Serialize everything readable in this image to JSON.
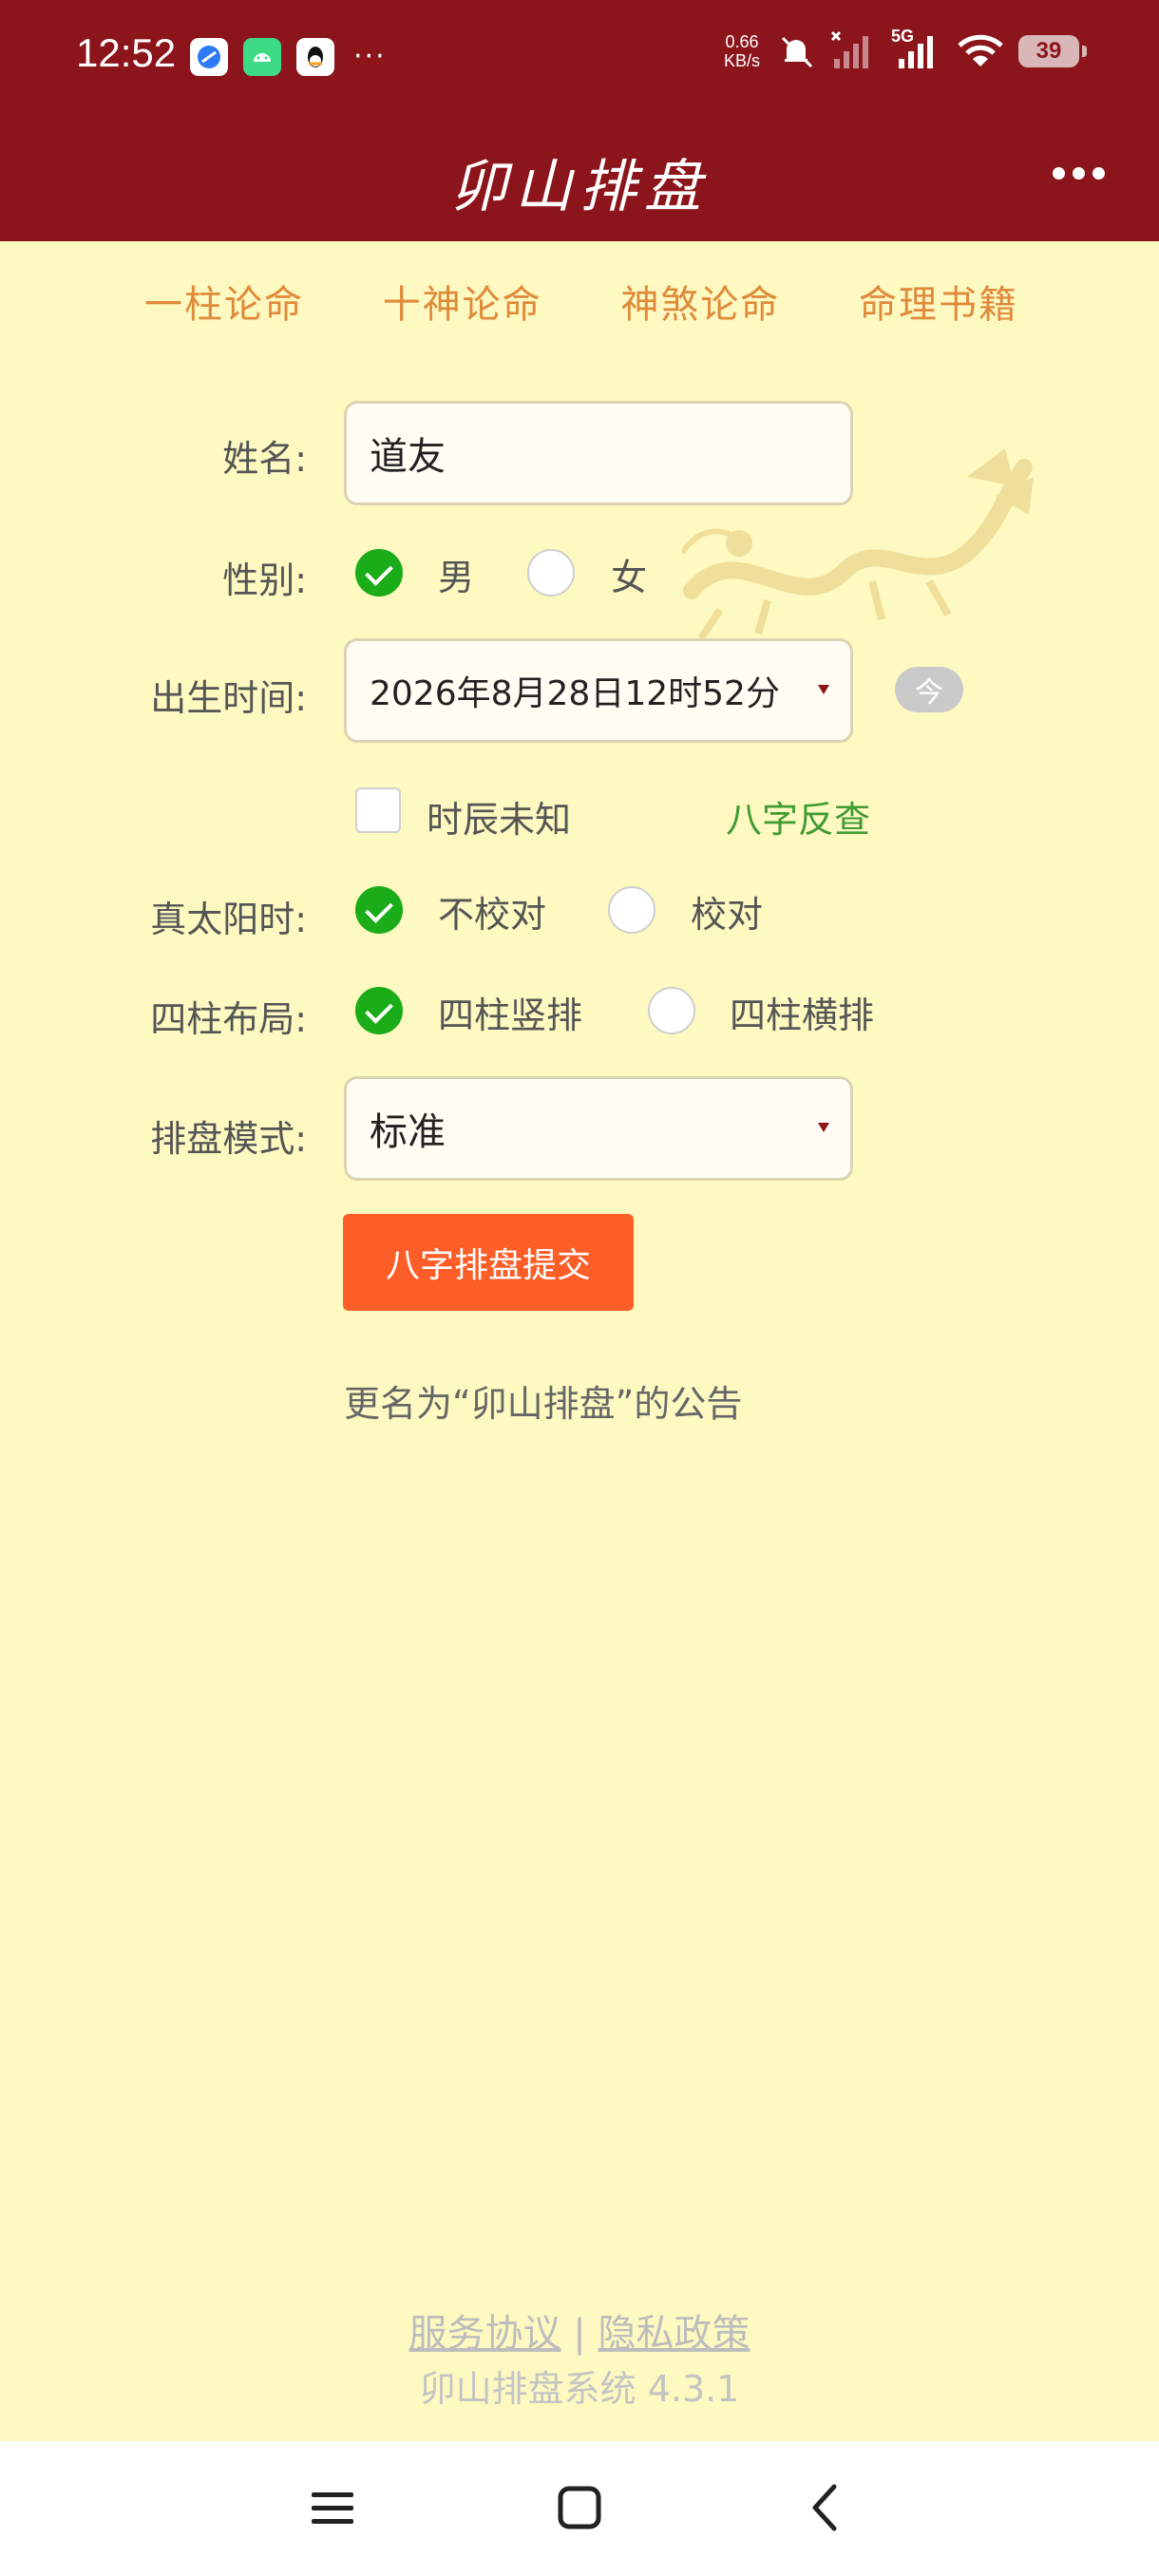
{
  "status_bar": {
    "time": "12:52",
    "more_indicator": "···",
    "net_speed_value": "0.66",
    "net_speed_unit": "KB/s",
    "network_type": "5G",
    "battery": "39"
  },
  "header": {
    "title": "卯山排盘"
  },
  "nav": {
    "items": [
      "一柱论命",
      "十神论命",
      "神煞论命",
      "命理书籍"
    ]
  },
  "form": {
    "name_label": "姓名:",
    "name_value": "道友",
    "gender_label": "性别:",
    "gender_male": "男",
    "gender_female": "女",
    "birth_label": "出生时间:",
    "birth_value": "2026年8月28日12时52分",
    "now_button": "今",
    "unknown_hour": "时辰未知",
    "reverse_lookup": "八字反查",
    "solar_label": "真太阳时:",
    "solar_no": "不校对",
    "solar_yes": "校对",
    "layout_label": "四柱布局:",
    "layout_vertical": "四柱竖排",
    "layout_horizontal": "四柱横排",
    "mode_label": "排盘模式:",
    "mode_value": "标准",
    "submit": "八字排盘提交"
  },
  "notice": "更名为“卯山排盘”的公告",
  "footer": {
    "service": "服务协议",
    "separator": "|",
    "privacy": "隐私政策",
    "version": "卯山排盘系统 4.3.1"
  },
  "colors": {
    "header": "#8c151c",
    "background": "#fdf9c1",
    "nav_text": "#e08a3a",
    "checked": "#1aad19",
    "submit": "#fd5d27",
    "link_green": "#3f9b32"
  }
}
